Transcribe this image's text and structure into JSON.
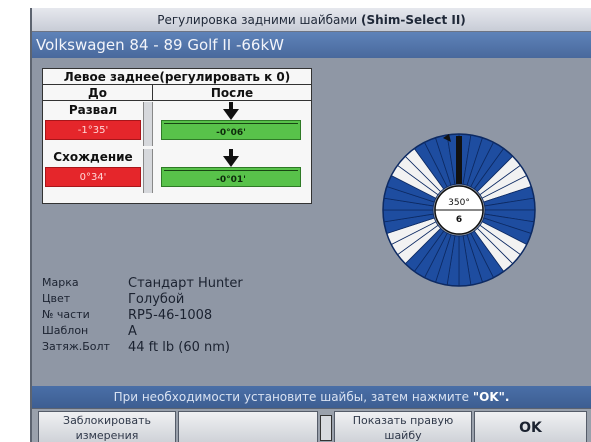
{
  "window": {
    "title_prefix": "Регулировка задними шайбами ",
    "title_bold": "(Shim-Select II)"
  },
  "vehicle": "Volkswagen 84 - 89 Golf II -66kW",
  "table": {
    "title": "Левое заднее(регулировать к 0)",
    "col_before": "До",
    "col_after": "После",
    "rows": [
      {
        "name": "Развал",
        "before": "-1°35'",
        "after": "-0°06'"
      },
      {
        "name": "Схождение",
        "before": "0°34'",
        "after": "-0°01'"
      }
    ]
  },
  "wheel": {
    "angle": "350°",
    "index": "6",
    "colors": {
      "ring": "#1e4da0",
      "segment_light": "#f2f2f2",
      "marker": "#111111"
    }
  },
  "info": [
    {
      "key": "Марка",
      "value": "Стандарт Hunter"
    },
    {
      "key": "Цвет",
      "value": "Голубой"
    },
    {
      "key": "№ части",
      "value": "RP5-46-1008"
    },
    {
      "key": "Шаблон",
      "value": "A"
    },
    {
      "key": "Затяж.Болт",
      "value": "44 ft lb (60 nm)"
    }
  ],
  "status": {
    "text": "При необходимости установите шайбы, затем нажмите ",
    "bold": "\"OK\"."
  },
  "buttons": {
    "lock": "Заблокировать измерения",
    "show_right": "Показать правую шайбу",
    "ok": "OK"
  },
  "colors": {
    "bad": "#e5262b",
    "good": "#58c24a",
    "header_blue": "#4f74ad"
  }
}
